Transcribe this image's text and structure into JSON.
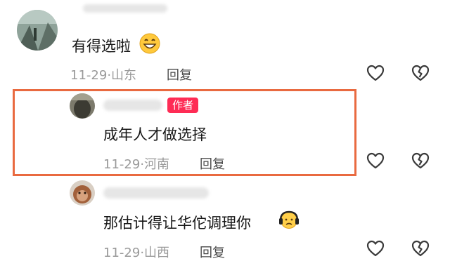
{
  "comments": [
    {
      "text": "有得选啦",
      "emoji": "grinning-emoji",
      "date": "11-29",
      "location": "山东",
      "reply_label": "回复"
    },
    {
      "author_tag": "作者",
      "text": "成年人才做选择",
      "date": "11-29",
      "location": "河南",
      "reply_label": "回复"
    },
    {
      "text": "那估计得让华佗调理你",
      "emoji": "worried-emoji",
      "date": "11-29",
      "location": "山西",
      "reply_label": "回复"
    }
  ],
  "meta_separator": "·",
  "icons": {
    "like": "heart-outline-icon",
    "dislike": "broken-heart-icon"
  },
  "colors": {
    "author_tag": "#fe2c55",
    "highlight_border": "#e96a40",
    "meta_text": "#9a9a9a"
  }
}
